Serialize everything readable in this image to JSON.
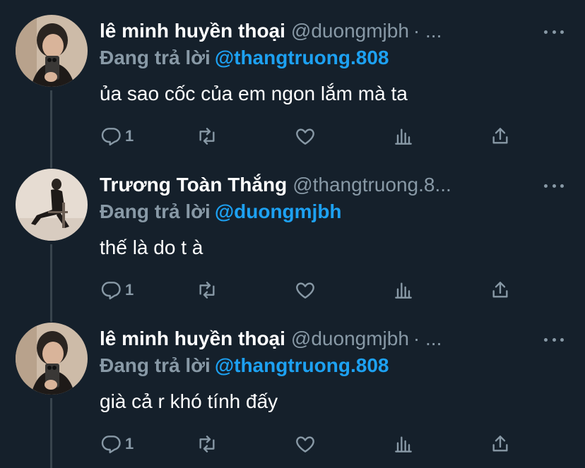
{
  "tweets": [
    {
      "name": "lê minh huyền thoại",
      "handle": "@duongmjbh",
      "time_ellipsis": "· ...",
      "reply_prefix": "Đang trả lời",
      "reply_to": "@thangtruong.808",
      "text": "ủa sao cốc của em ngon lắm mà ta",
      "reply_count": "1",
      "avatar": "selfie-avatar"
    },
    {
      "name": "Trương Toàn Thắng",
      "handle": "@thangtruong.8...",
      "time_ellipsis": "",
      "reply_prefix": "Đang trả lời",
      "reply_to": "@duongmjbh",
      "text": "thế là do t à",
      "reply_count": "1",
      "avatar": "seated-figure-avatar"
    },
    {
      "name": "lê minh huyền thoại",
      "handle": "@duongmjbh",
      "time_ellipsis": "· ...",
      "reply_prefix": "Đang trả lời",
      "reply_to": "@thangtruong.808",
      "text": "già cả r khó tính đấy",
      "reply_count": "1",
      "avatar": "selfie-avatar"
    }
  ],
  "icons": {
    "reply": "reply-icon",
    "retweet": "retweet-icon",
    "like": "heart-icon",
    "analytics": "analytics-icon",
    "share": "share-icon",
    "more": "more-icon"
  },
  "colors": {
    "background": "#15202b",
    "secondary_text": "#8899a6",
    "accent": "#1da1f2",
    "thread_line": "#38444d"
  }
}
